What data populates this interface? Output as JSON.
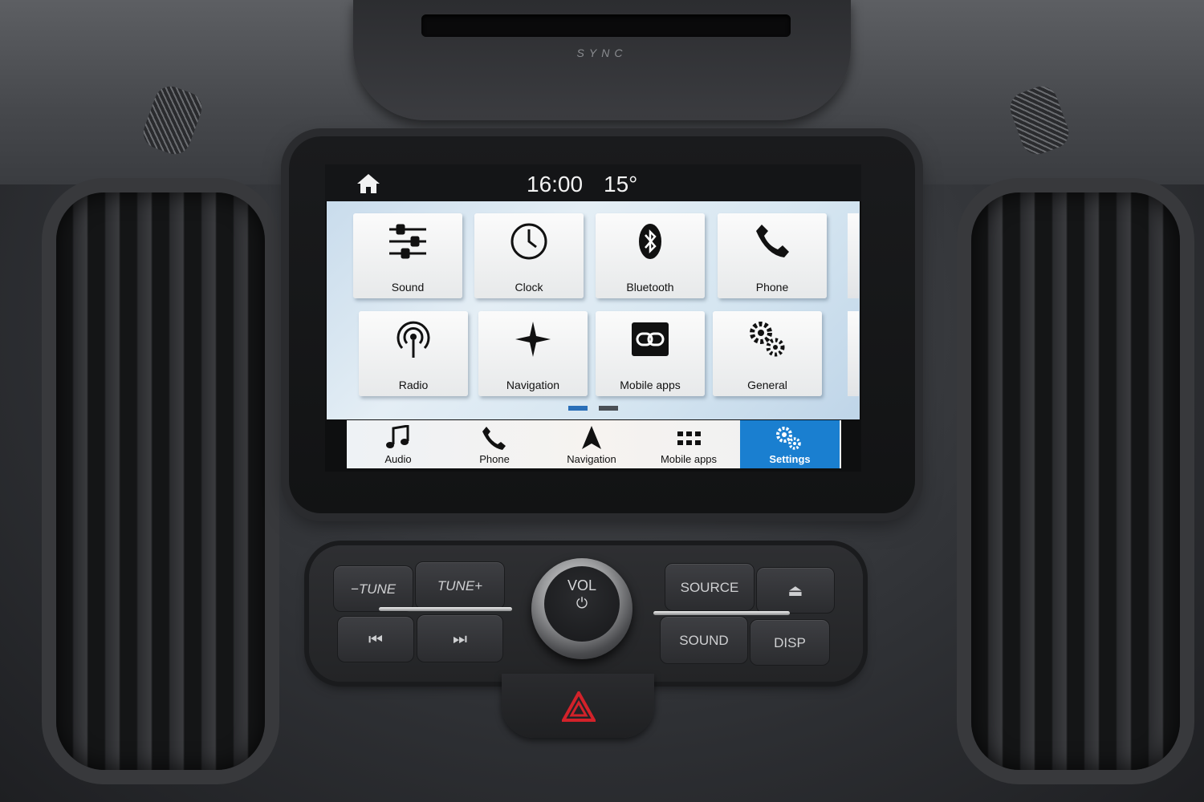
{
  "bezel": {
    "brand_logo": "SYNC"
  },
  "status": {
    "time": "16:00",
    "temperature": "15°"
  },
  "tiles": [
    {
      "label": "Sound",
      "icon": "sliders-icon"
    },
    {
      "label": "Clock",
      "icon": "clock-icon"
    },
    {
      "label": "Bluetooth",
      "icon": "bluetooth-icon"
    },
    {
      "label": "Phone",
      "icon": "phone-icon"
    },
    {
      "label": "Radio",
      "icon": "radio-icon"
    },
    {
      "label": "Navigation",
      "icon": "compass-star-icon"
    },
    {
      "label": "Mobile apps",
      "icon": "link-icon"
    },
    {
      "label": "General",
      "icon": "gears-icon"
    }
  ],
  "page_dots": {
    "count": 2,
    "active": 1
  },
  "navbar": [
    {
      "label": "Audio",
      "icon": "music-note-icon"
    },
    {
      "label": "Phone",
      "icon": "phone-icon"
    },
    {
      "label": "Navigation",
      "icon": "arrow-icon"
    },
    {
      "label": "Mobile apps",
      "icon": "grid-icon"
    },
    {
      "label": "Settings",
      "icon": "gears-icon",
      "active": true
    }
  ],
  "controls": {
    "tune_down": "−TUNE",
    "tune_up": "TUNE+",
    "seek_back": "⏮",
    "seek_forward": "⏭",
    "volume": "VOL",
    "power": "⏻",
    "source": "SOURCE",
    "eject": "⏏",
    "sound": "SOUND",
    "disp": "DISP"
  },
  "colors": {
    "accent": "#1a7fd0",
    "hazard": "#d3222a"
  }
}
